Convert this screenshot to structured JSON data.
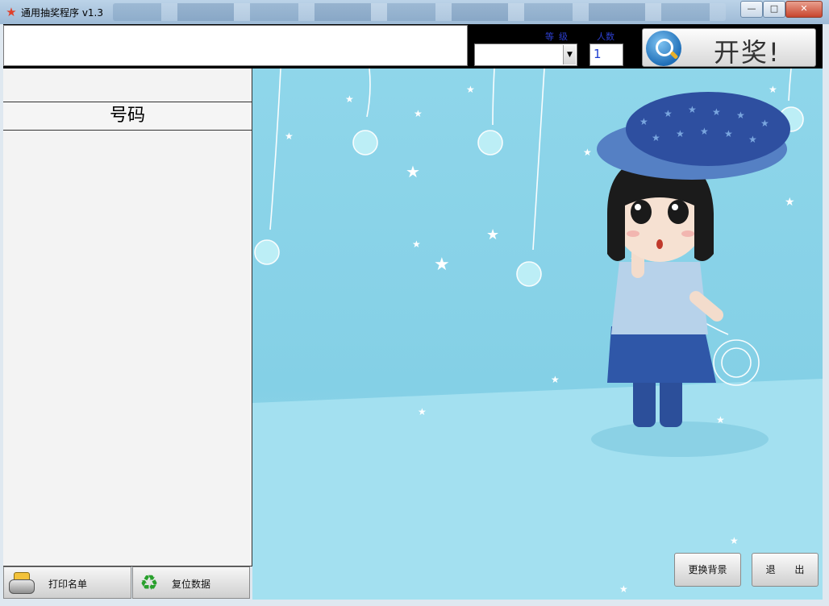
{
  "window": {
    "title": "通用抽奖程序 v1.3",
    "minimize": "—",
    "maximize": "□",
    "close": "✕"
  },
  "toolbar": {
    "level_label": "等级",
    "count_label": "人数",
    "level_value": "",
    "count_value": "1",
    "draw_button": "开奖!"
  },
  "list": {
    "header": "号码",
    "items": []
  },
  "bottom": {
    "print_button": "打印名单",
    "reset_button": "复位数据",
    "change_bg_button": "更换背景",
    "exit_button": "退 出"
  },
  "icons": {
    "app": "star-icon",
    "draw": "magnifier-icon",
    "print": "printer-icon",
    "reset": "recycle-icon"
  },
  "colors": {
    "accent_blue": "#2d3fd0",
    "background_sky": "#8fd6ea"
  }
}
